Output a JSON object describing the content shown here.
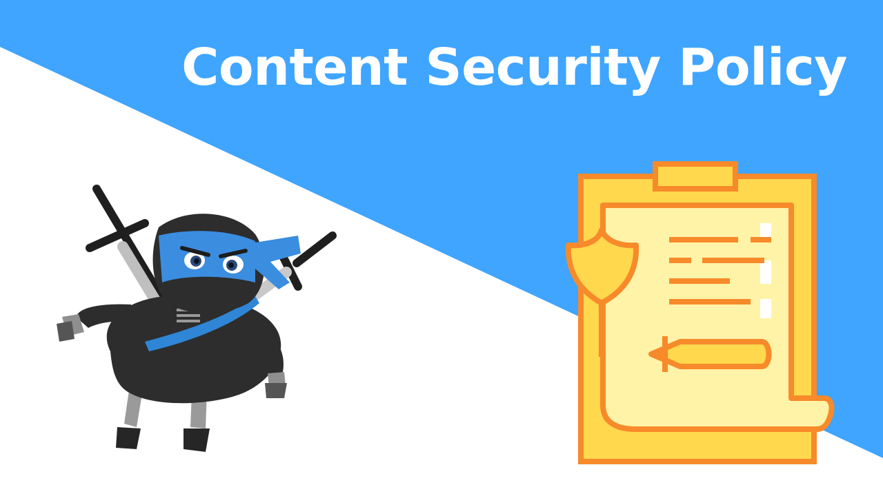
{
  "banner": {
    "title": "Content Security Policy",
    "colors": {
      "background_white": "#ffffff",
      "background_blue": "#3fa5ff",
      "title_text": "#ffffff",
      "ninja_body": "#2b2b2b",
      "ninja_headband": "#3b8de0",
      "policy_outline": "#f78a2a",
      "policy_paper": "#fff3a8",
      "shield_fill": "#ffd84d"
    }
  },
  "illustrations": {
    "ninja": "ninja-mascot",
    "policy": "clipboard-with-shield-and-pen"
  }
}
